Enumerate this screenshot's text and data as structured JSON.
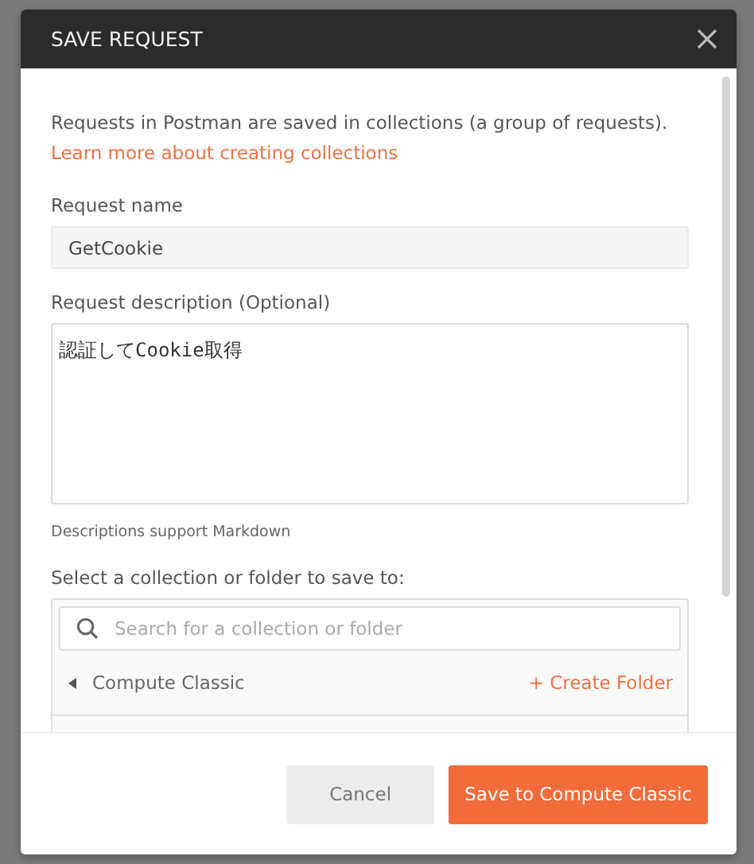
{
  "dialog": {
    "title": "SAVE REQUEST",
    "intro": "Requests in Postman are saved in collections (a group of requests).",
    "learn_more_link": "Learn more about creating collections",
    "request_name": {
      "label": "Request name",
      "value": "GetCookie"
    },
    "request_description": {
      "label": "Request description (Optional)",
      "value": "認証してCookie取得",
      "hint": "Descriptions support Markdown"
    },
    "collection_picker": {
      "label": "Select a collection or folder to save to:",
      "search": {
        "placeholder": "Search for a collection or folder"
      },
      "collections": [
        {
          "name": "Compute Classic",
          "expanded": false,
          "action": "+ Create Folder"
        }
      ]
    },
    "buttons": [
      {
        "label": "Cancel",
        "kind": "secondary"
      },
      {
        "label": "Save to Compute Classic",
        "kind": "primary"
      }
    ]
  }
}
